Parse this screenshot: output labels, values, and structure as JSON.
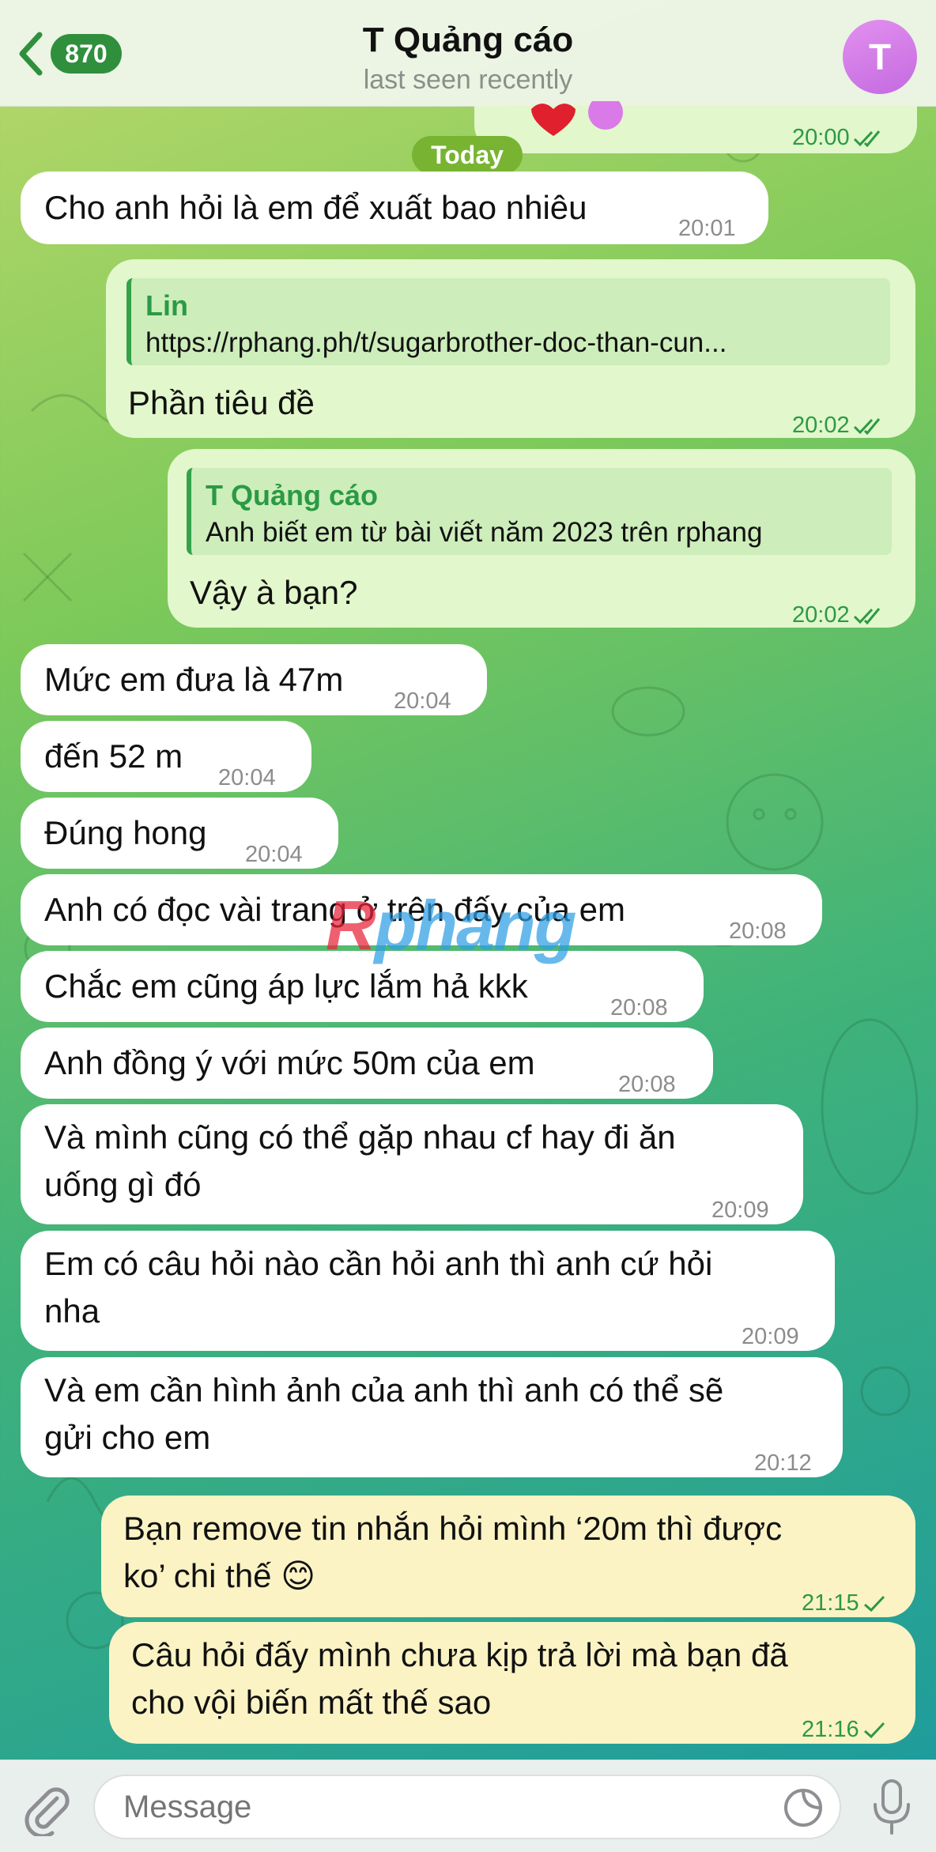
{
  "header": {
    "back_count": "870",
    "title": "T Quảng cáo",
    "status": "last seen recently",
    "avatar_letter": "T"
  },
  "chat": {
    "date_separator": "Today",
    "previous_time": "20:00",
    "messages": [
      {
        "side": "in",
        "text": "Cho anh hỏi là em để xuất bao nhiêu",
        "time": "20:01"
      },
      {
        "side": "out",
        "reply_name": "Lin",
        "reply_text": "https://rphang.ph/t/sugarbrother-doc-than-cun...",
        "text": "Phần tiêu đề",
        "time": "20:02",
        "status": "read"
      },
      {
        "side": "out",
        "reply_name": "T Quảng cáo",
        "reply_text": "Anh biết em từ bài viết năm 2023 trên rphang",
        "text": "Vậy à bạn?",
        "time": "20:02",
        "status": "read"
      },
      {
        "side": "in",
        "text": "Mức em đưa là 47m",
        "time": "20:04"
      },
      {
        "side": "in",
        "text": "đến 52 m",
        "time": "20:04"
      },
      {
        "side": "in",
        "text": "Đúng hong",
        "time": "20:04"
      },
      {
        "side": "in",
        "text": "Anh có đọc vài trang ở trên đấy của em",
        "time": "20:08"
      },
      {
        "side": "in",
        "text": "Chắc em cũng áp lực lắm hả kkk",
        "time": "20:08"
      },
      {
        "side": "in",
        "text": "Anh đồng ý với mức 50m của em",
        "time": "20:08"
      },
      {
        "side": "in",
        "text": "Và mình cũng có thể gặp nhau cf hay đi ăn\nuống gì đó",
        "time": "20:09"
      },
      {
        "side": "in",
        "text": "Em có câu hỏi nào cần hỏi anh thì anh cứ hỏi\nnha",
        "time": "20:09"
      },
      {
        "side": "in",
        "text": "Và em cần hình ảnh của anh thì anh có thể sẽ\ngửi cho em",
        "time": "20:12"
      },
      {
        "side": "out",
        "text": "Bạn remove tin nhắn hỏi mình ‘20m thì được\nko’ chi thế 😊",
        "time": "21:15",
        "status": "sent"
      },
      {
        "side": "out",
        "text": "Câu hỏi đấy mình chưa kịp trả lời mà bạn đã\ncho vội biến mất thế sao",
        "time": "21:16",
        "status": "sent"
      }
    ]
  },
  "watermark": {
    "first": "R",
    "rest": "phang"
  },
  "composer": {
    "placeholder": "Message"
  },
  "colors": {
    "accent": "#2f8f3d",
    "outgoing_bubble": "#e2f7cb",
    "incoming_bubble": "#ffffff",
    "highlighted_bubble": "#fbf3c4",
    "watermark_red": "#e8243a",
    "watermark_blue": "#2e9fe6"
  },
  "icons": {
    "back": "chevron-left-icon",
    "attach": "paperclip-icon",
    "sticker": "sticker-icon",
    "mic": "microphone-icon",
    "double_check": "double-check-icon",
    "single_check": "check-icon"
  }
}
